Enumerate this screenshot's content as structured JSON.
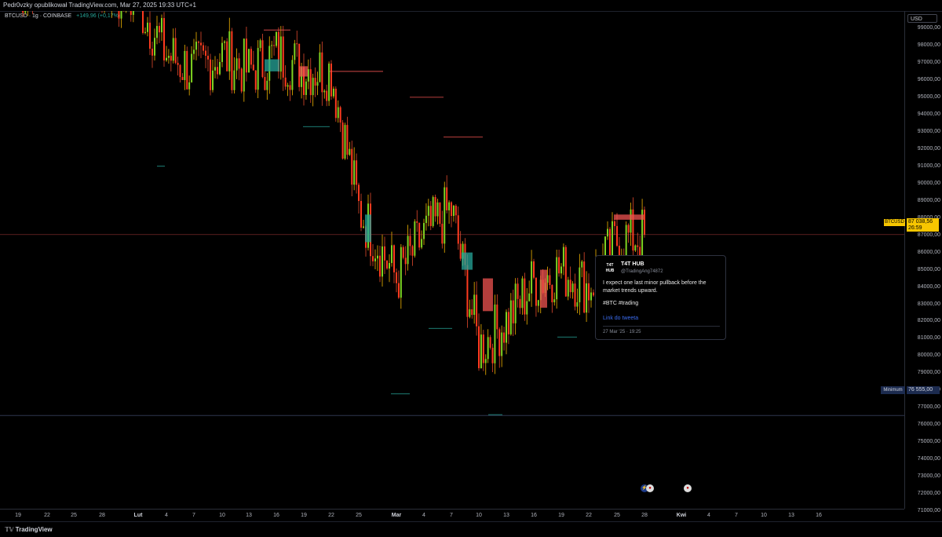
{
  "header": {
    "publish_line": "Pedr0vzky opublikował TradingView.com, Mar 27, 2025 19:33 UTC+1"
  },
  "legend": {
    "symbol": "BTCUSD · 1g · COINBASE",
    "change": "+149,96 (+0,17%)"
  },
  "price_axis": {
    "currency": "USD",
    "ticks": [
      "99000,00",
      "98000,00",
      "97000,00",
      "96000,00",
      "95000,00",
      "94000,00",
      "93000,00",
      "92000,00",
      "91000,00",
      "90000,00",
      "89000,00",
      "88000,00",
      "87000,00",
      "86000,00",
      "85000,00",
      "84000,00",
      "83000,00",
      "82000,00",
      "81000,00",
      "80000,00",
      "79000,00",
      "78000,00",
      "77000,00",
      "76000,00",
      "75000,00",
      "74000,00",
      "73000,00",
      "72000,00",
      "71000,00"
    ],
    "current_symbol": "BTCUSD",
    "current_price": "87 038,56",
    "countdown": "26:59",
    "min_label": "Minimum",
    "min_price": "76 555,00"
  },
  "time_axis": {
    "ticks": [
      "19",
      "22",
      "25",
      "28",
      "Lut",
      "4",
      "7",
      "10",
      "13",
      "16",
      "19",
      "22",
      "25",
      "Mar",
      "4",
      "7",
      "10",
      "13",
      "16",
      "19",
      "22",
      "25",
      "28",
      "Kwi",
      "4",
      "7",
      "10",
      "13",
      "16"
    ]
  },
  "tweet": {
    "avatar": "T4T HUB",
    "name": "T4T HUB",
    "handle": "@TradingAng74872",
    "text": "I expect one last minor pullback before the market trends upward.",
    "tags": "#BTC #trading",
    "link": "Link do tweeta",
    "date": "27 Mar '25 · 19:25"
  },
  "footer": {
    "brand": "TradingView"
  },
  "colors": {
    "up": "#26a69a",
    "down": "#ef5350",
    "price_tag": "#f7c600",
    "min_tag": "#1c2b4f",
    "background": "#000000"
  },
  "chart_data": {
    "type": "line",
    "ylabel": "",
    "xlabel": "",
    "ylim": [
      70500,
      100000
    ],
    "x": [
      "Jan 19",
      "Jan 22",
      "Jan 25",
      "Jan 28",
      "Feb 1",
      "Feb 4",
      "Feb 7",
      "Feb 10",
      "Feb 13",
      "Feb 16",
      "Feb 19",
      "Feb 22",
      "Feb 25",
      "Mar 1",
      "Mar 4",
      "Mar 7",
      "Mar 10",
      "Mar 13",
      "Mar 16",
      "Mar 19",
      "Mar 22",
      "Mar 25",
      "Mar 27"
    ],
    "series": [
      {
        "values": [
          101000,
          102500,
          105000,
          101500,
          100500,
          97500,
          96500,
          97500,
          96500,
          97500,
          96700,
          96500,
          88500,
          84500,
          87000,
          88500,
          80500,
          82000,
          84300,
          85000,
          84000,
          86700,
          87038
        ]
      }
    ],
    "current_price": 87038.56,
    "minimum": 76555
  }
}
